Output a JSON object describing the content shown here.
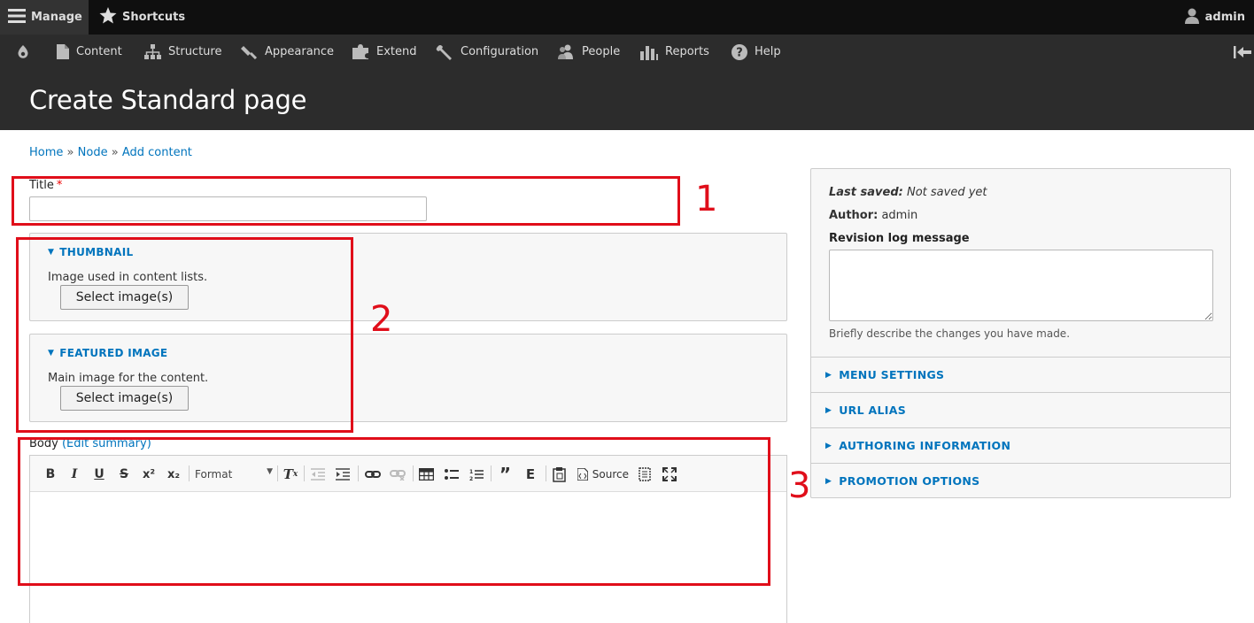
{
  "toolbar": {
    "manage": "Manage",
    "shortcuts": "Shortcuts",
    "user": "admin",
    "tray": [
      {
        "label": "Content"
      },
      {
        "label": "Structure"
      },
      {
        "label": "Appearance"
      },
      {
        "label": "Extend"
      },
      {
        "label": "Configuration"
      },
      {
        "label": "People"
      },
      {
        "label": "Reports"
      },
      {
        "label": "Help"
      }
    ]
  },
  "page": {
    "title": "Create Standard page"
  },
  "breadcrumb": {
    "home": "Home",
    "node": "Node",
    "add": "Add content",
    "sep": "»"
  },
  "form": {
    "title_label": "Title",
    "required_mark": "*",
    "thumbnail": {
      "summary": "THUMBNAIL",
      "description": "Image used in content lists.",
      "button": "Select image(s)"
    },
    "featured": {
      "summary": "FEATURED IMAGE",
      "description": "Main image for the content.",
      "button": "Select image(s)"
    },
    "body_label": "Body",
    "edit_summary": "(Edit summary)",
    "editor": {
      "format_label": "Format",
      "source_label": "Source"
    }
  },
  "sidebar": {
    "last_saved_label": "Last saved:",
    "last_saved_value": "Not saved yet",
    "author_label": "Author:",
    "author_value": "admin",
    "revision_label": "Revision log message",
    "revision_desc": "Briefly describe the changes you have made.",
    "sections": [
      "MENU SETTINGS",
      "URL ALIAS",
      "AUTHORING INFORMATION",
      "PROMOTION OPTIONS"
    ]
  },
  "annotations": {
    "one": "1",
    "two": "2",
    "three": "3"
  },
  "colors": {
    "link": "#0074bd",
    "annotation": "#e00e1a",
    "toolbar_bg": "#0f0f0f",
    "header_bg": "#2c2c2c"
  }
}
